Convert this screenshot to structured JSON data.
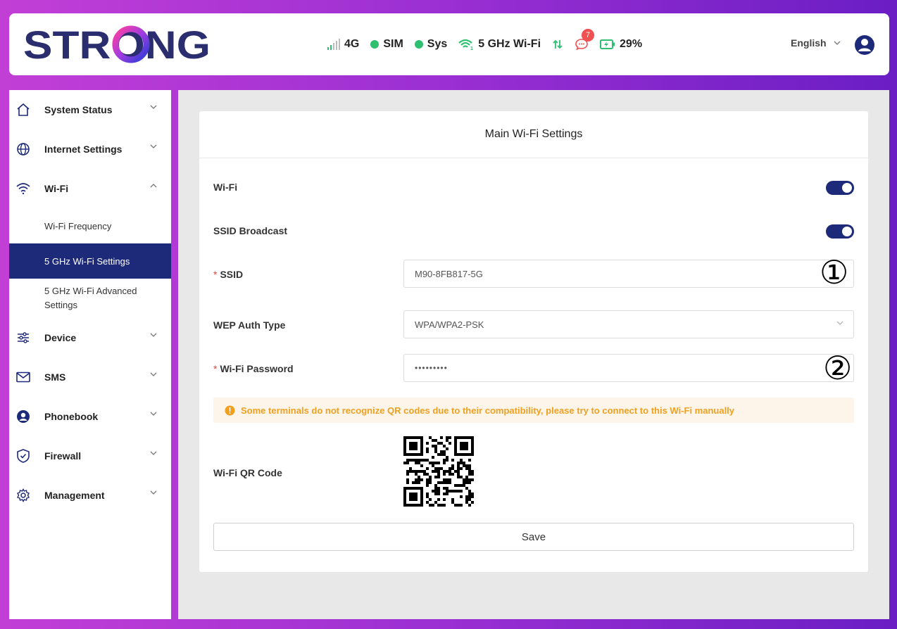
{
  "header": {
    "logo_text": "STRONG",
    "status": {
      "network": "4G",
      "sim": "SIM",
      "sys": "Sys",
      "wifi": "5 GHz Wi-Fi",
      "messages_count": "7",
      "battery": "29%"
    },
    "language": "English"
  },
  "sidebar": {
    "items": [
      {
        "label": "System Status",
        "icon": "home-icon"
      },
      {
        "label": "Internet Settings",
        "icon": "globe-icon"
      },
      {
        "label": "Wi-Fi",
        "icon": "wifi-icon"
      },
      {
        "label": "Device",
        "icon": "sliders-icon"
      },
      {
        "label": "SMS",
        "icon": "mail-icon"
      },
      {
        "label": "Phonebook",
        "icon": "contact-icon"
      },
      {
        "label": "Firewall",
        "icon": "shield-icon"
      },
      {
        "label": "Management",
        "icon": "gear-icon"
      }
    ],
    "wifi_sub": [
      "Wi-Fi Frequency",
      "5 GHz Wi-Fi Settings",
      "5 GHz Wi-Fi Advanced Settings"
    ]
  },
  "main": {
    "title": "Main Wi-Fi Settings",
    "wifi_label": "Wi-Fi",
    "ssid_broadcast_label": "SSID Broadcast",
    "ssid_label": "SSID",
    "ssid_value": "M90-8FB817-5G",
    "auth_label": "WEP Auth Type",
    "auth_value": "WPA/WPA2-PSK",
    "password_label": "Wi-Fi Password",
    "password_value": "•••••••••",
    "alert": "Some terminals do not recognize QR codes due to their compatibility, please try to connect to this Wi-Fi manually",
    "qr_label": "Wi-Fi QR Code",
    "save_label": "Save",
    "annotation_1": "①",
    "annotation_2": "②"
  },
  "colors": {
    "accent": "#1d2a7a",
    "status_green": "#2fbf71",
    "warning": "#f0a020",
    "badge": "#f0504f"
  }
}
